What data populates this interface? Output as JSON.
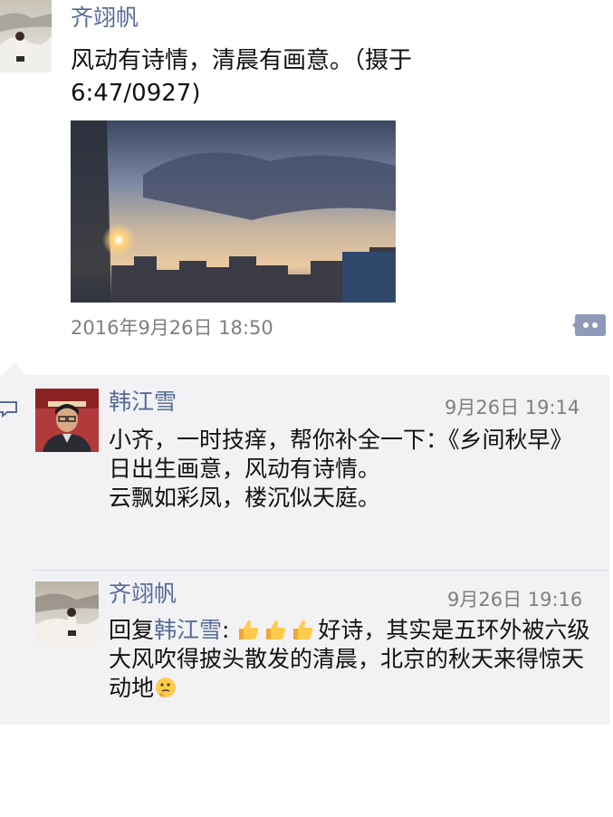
{
  "post": {
    "author": "齐翊帆",
    "text": "风动有诗情，清晨有画意。（摄于6:47/0927)",
    "image_icon": "sunrise-cityscape-photo",
    "timestamp": "2016年9月26日 18:50",
    "comment_icon": "comment-dots-icon"
  },
  "comments": [
    {
      "author": "韩江雪",
      "time": "9月26日 19:14",
      "lines": [
        "小齐，一时技痒，帮你补全一下：《乡间秋早》",
        "日出生画意，风动有诗情。",
        "云飘如彩凤，楼沉似天庭。"
      ]
    },
    {
      "author": "齐翊帆",
      "time": "9月26日 19:16",
      "reply_prefix": "回复",
      "reply_to": "韩江雪",
      "reply_colon": ":",
      "emoji": [
        "thumbs-up-emoji",
        "thumbs-up-emoji",
        "thumbs-up-emoji"
      ],
      "text": "好诗，其实是五环外被六级大风吹得披头散发的清晨，北京的秋天来得惊天动地",
      "trailing_emoji": "thinking-face-emoji"
    }
  ]
}
